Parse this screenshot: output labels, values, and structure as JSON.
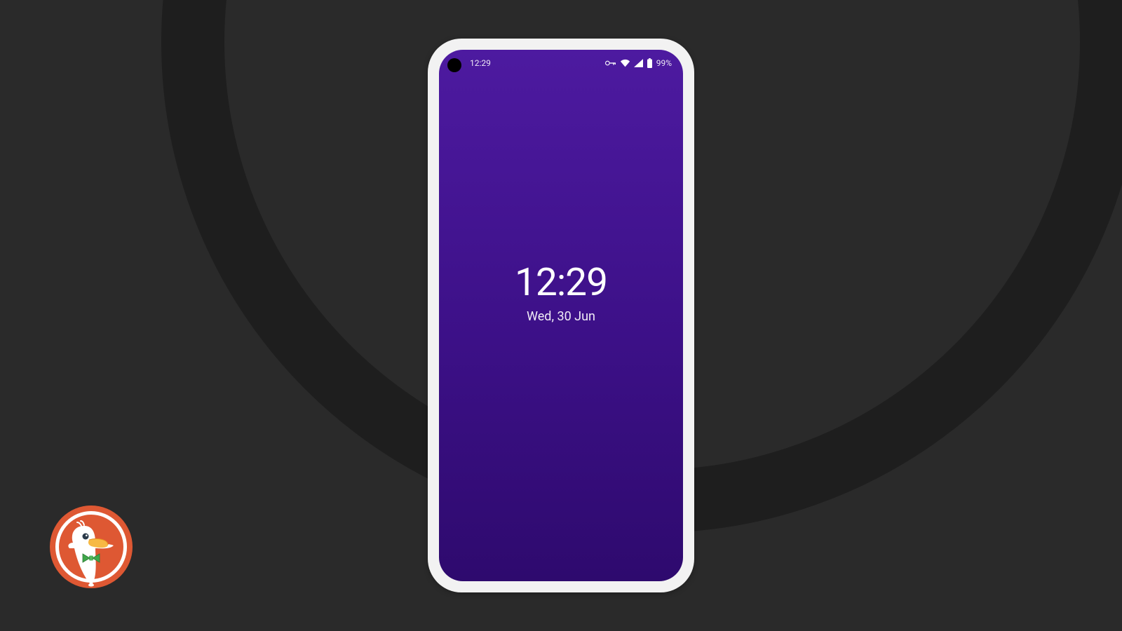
{
  "status_bar": {
    "time": "12:29",
    "battery_pct": "99%",
    "icons": {
      "vpn": "vpn-key-icon",
      "wifi": "wifi-icon",
      "signal": "cell-signal-icon",
      "battery": "battery-icon"
    }
  },
  "lock_screen": {
    "time": "12:29",
    "date": "Wed, 30 Jun"
  },
  "colors": {
    "background_dark": "#2a2a2a",
    "ring": "#1e1e1e",
    "screen_top": "#4d1aa0",
    "screen_bottom": "#2e0a6e",
    "logo_orange": "#de5833",
    "logo_green": "#4caf50"
  },
  "logo": {
    "name": "duckduckgo-logo"
  }
}
